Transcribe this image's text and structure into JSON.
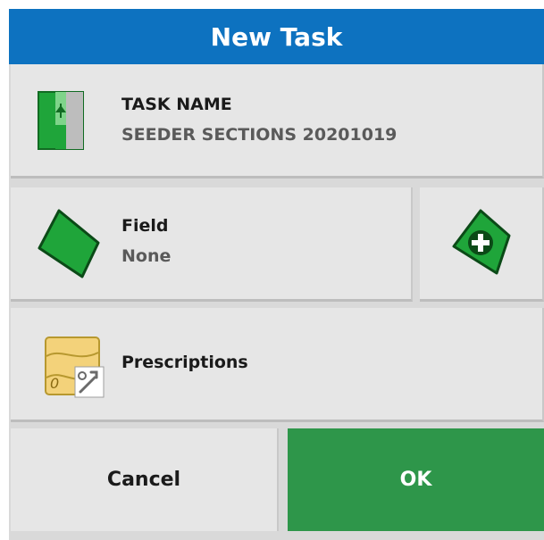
{
  "dialog": {
    "title": "New Task"
  },
  "task_name": {
    "label": "TASK NAME",
    "value": "SEEDER SECTIONS 20201019",
    "icon": "task-name-icon"
  },
  "field": {
    "label": "Field",
    "value": "None",
    "icon": "field-icon",
    "add_icon": "add-field-icon"
  },
  "prescriptions": {
    "label": "Prescriptions",
    "icon": "prescription-map-icon"
  },
  "actions": {
    "cancel_label": "Cancel",
    "ok_label": "OK"
  },
  "colors": {
    "title_bar": "#0d72c0",
    "ok_button": "#2e964a",
    "button": "#e6e6e6",
    "field_green": "#1fa53a"
  }
}
